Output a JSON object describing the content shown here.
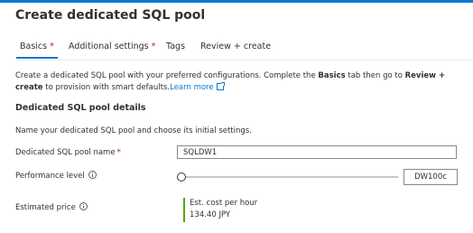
{
  "page": {
    "title": "Create dedicated SQL pool"
  },
  "tabs": [
    {
      "label": "Basics",
      "required": "*"
    },
    {
      "label": "Additional settings",
      "required": "*"
    },
    {
      "label": "Tags",
      "required": ""
    },
    {
      "label": "Review + create",
      "required": ""
    }
  ],
  "intro": {
    "part1": "Create a dedicated SQL pool with your preferred configurations. Complete the ",
    "bold1": "Basics",
    "part2": " tab then go to ",
    "bold2": "Review + create",
    "part3": " to provision with smart defaults.",
    "learn_more": "Learn more"
  },
  "details": {
    "title": "Dedicated SQL pool details",
    "description": "Name your dedicated SQL pool and choose its initial settings."
  },
  "form": {
    "name_label": "Dedicated SQL pool name",
    "name_required": "*",
    "name_value": "SQLDW1",
    "performance_label": "Performance level",
    "performance_value": "DW100c",
    "performance_slider_level": 0,
    "price_label": "Estimated price",
    "price_heading": "Est. cost per hour",
    "price_value": "134.40 JPY"
  },
  "colors": {
    "accent": "#0078d4",
    "required": "#a4262c",
    "price_bar": "#57a300"
  },
  "icons": [
    "external-link-icon",
    "info-icon"
  ]
}
